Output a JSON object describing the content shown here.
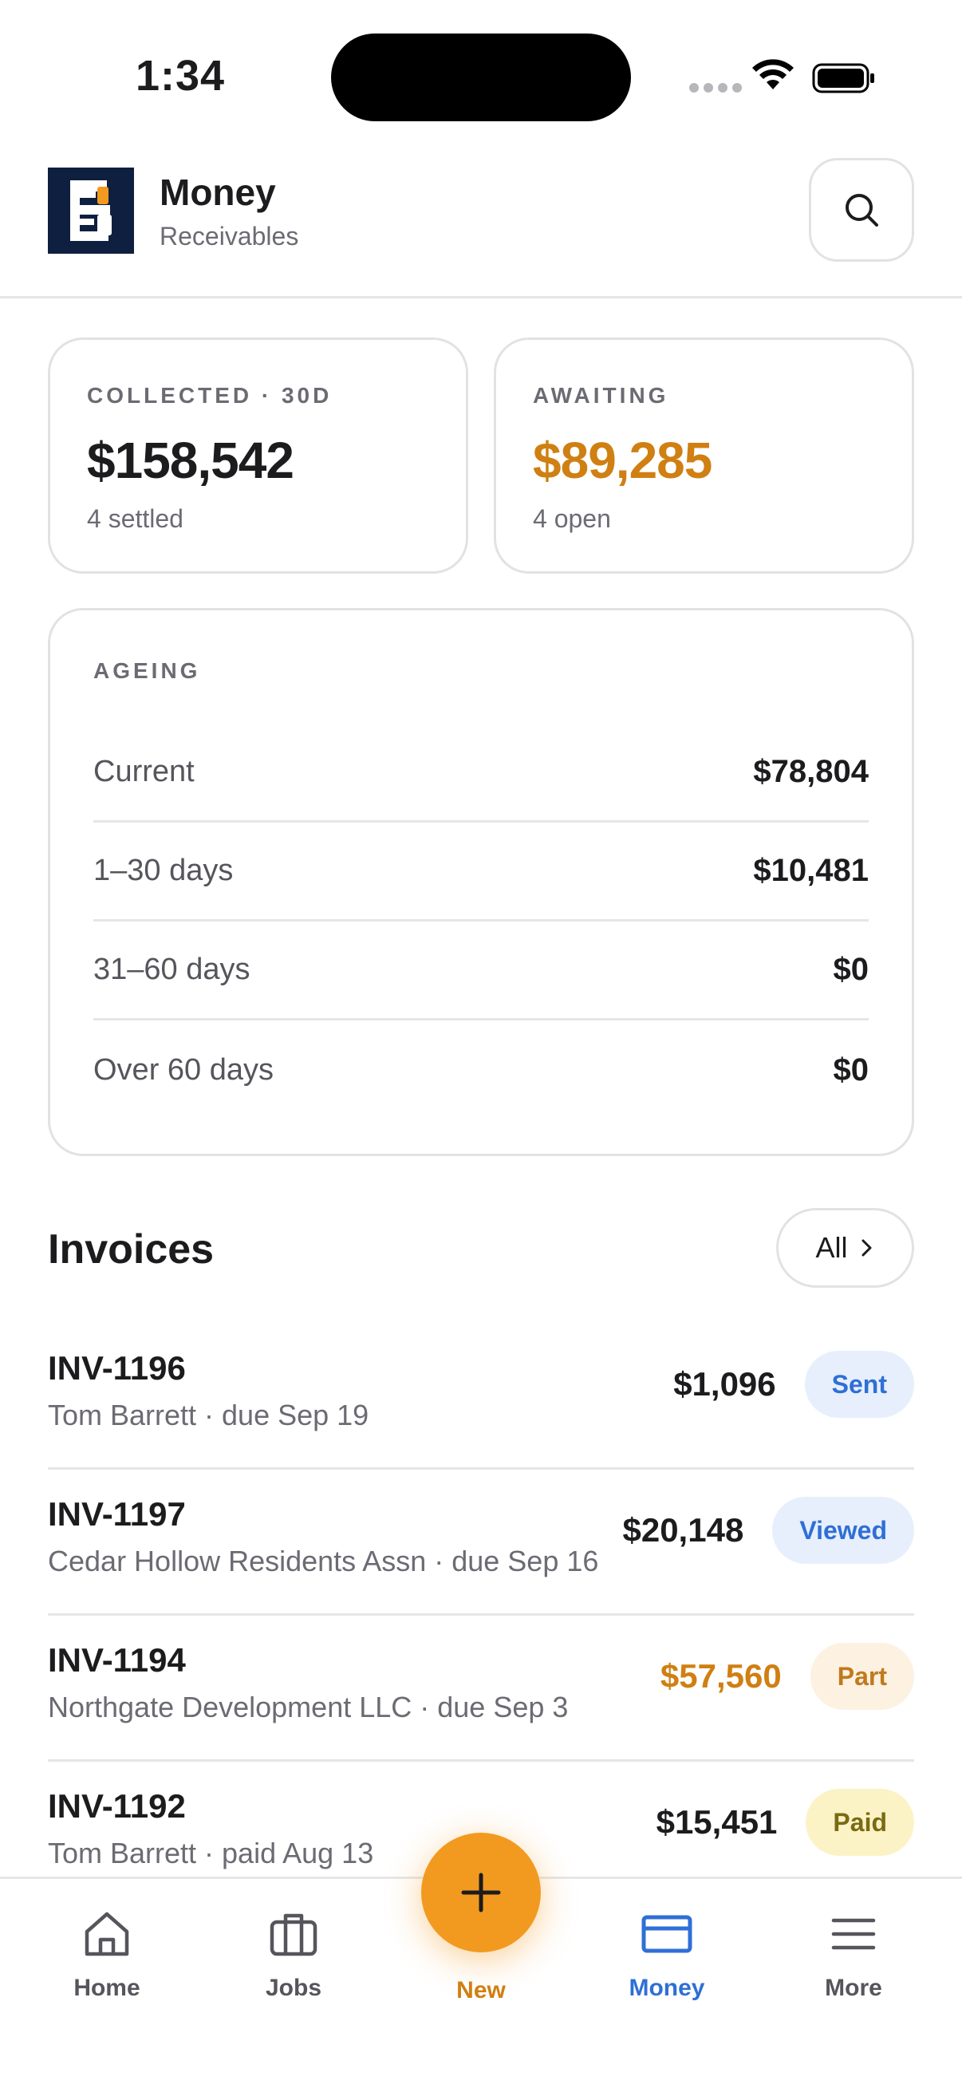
{
  "status_bar": {
    "time": "1:34"
  },
  "header": {
    "title": "Money",
    "subtitle": "Receivables"
  },
  "stats": {
    "collected": {
      "label": "COLLECTED · 30D",
      "value": "$158,542",
      "sub": "4 settled"
    },
    "awaiting": {
      "label": "AWAITING",
      "value": "$89,285",
      "sub": "4 open"
    }
  },
  "ageing": {
    "label": "AGEING",
    "rows": [
      {
        "name": "Current",
        "value": "$78,804"
      },
      {
        "name": "1–30 days",
        "value": "$10,481"
      },
      {
        "name": "31–60 days",
        "value": "$0"
      },
      {
        "name": "Over 60 days",
        "value": "$0"
      }
    ]
  },
  "invoices": {
    "title": "Invoices",
    "filter_label": "All",
    "items": [
      {
        "id": "INV-1196",
        "sub": "Tom Barrett · due Sep 19",
        "amount": "$1,096",
        "status": "Sent"
      },
      {
        "id": "INV-1197",
        "sub": "Cedar Hollow Residents Assn · due Sep 16",
        "amount": "$20,148",
        "status": "Viewed"
      },
      {
        "id": "INV-1194",
        "sub": "Northgate Development LLC · due Sep 3",
        "amount": "$57,560",
        "status": "Part"
      },
      {
        "id": "INV-1192",
        "sub": "Tom Barrett · paid Aug 13",
        "amount": "$15,451",
        "status": "Paid"
      }
    ]
  },
  "nav": {
    "home": "Home",
    "jobs": "Jobs",
    "new": "New",
    "money": "Money",
    "more": "More"
  },
  "colors": {
    "accent_orange": "#f29a1f",
    "awaiting_orange": "#d07f12",
    "active_blue": "#2f6fd6",
    "sent_badge_bg": "#e7effc",
    "part_badge_bg": "#fdf1e2",
    "paid_badge_bg": "#fbf3c6",
    "logo_navy": "#0f1f3f"
  }
}
